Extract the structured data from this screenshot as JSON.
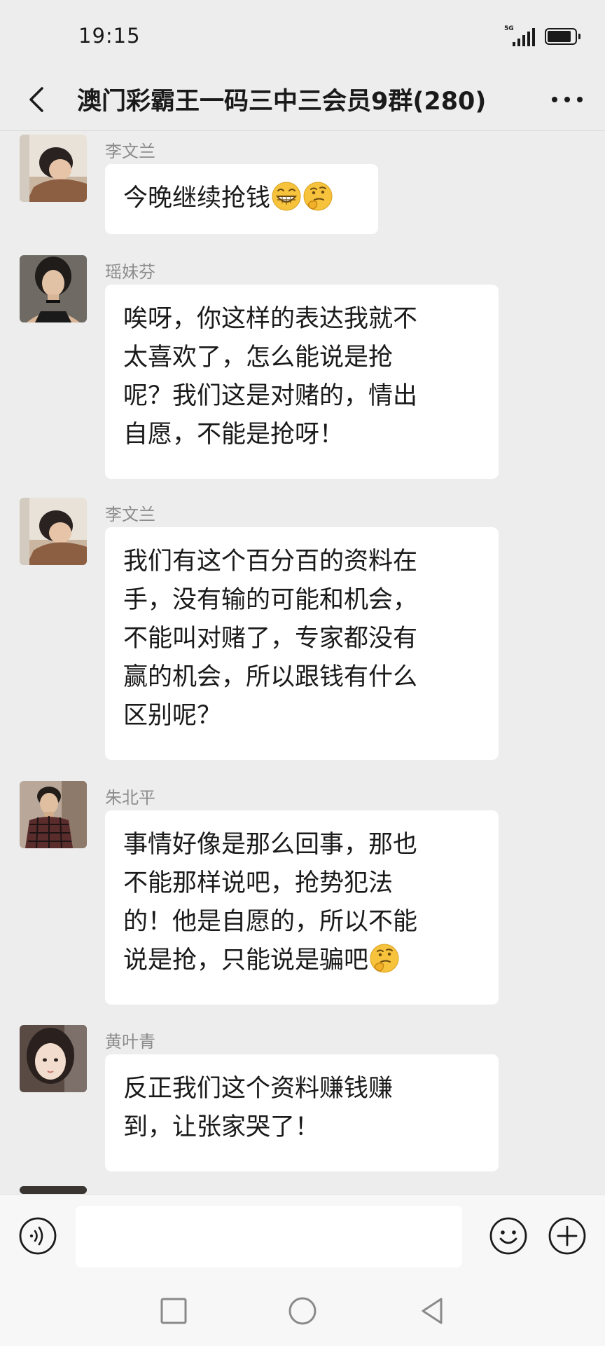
{
  "status_bar": {
    "time": "19:15",
    "network": "5G",
    "battery_level": 0.9
  },
  "header": {
    "back_icon": "chevron-left-icon",
    "title": "澳门彩霸王一码三中三会员9群(280)",
    "more_icon": "ellipsis-icon"
  },
  "messages": [
    {
      "sender": "李文兰",
      "avatar": "woman-lying-photo",
      "lines": [
        "今晚继续抢钱"
      ],
      "emojis": [
        "grinning-face",
        "thinking-face"
      ]
    },
    {
      "sender": "瑶妹芬",
      "avatar": "woman-choker-photo",
      "lines": [
        "唉呀，你这样的表达我就不",
        "太喜欢了，怎么能说是抢",
        "呢？我们这是对赌的，情出",
        "自愿，不能是抢呀！"
      ],
      "emojis": []
    },
    {
      "sender": "李文兰",
      "avatar": "woman-lying-photo",
      "lines": [
        "我们有这个百分百的资料在",
        "手，没有输的可能和机会，",
        "不能叫对赌了，专家都没有",
        "赢的机会，所以跟钱有什么",
        "区别呢？"
      ],
      "emojis": []
    },
    {
      "sender": "朱北平",
      "avatar": "man-plaid-shirt-photo",
      "lines": [
        "事情好像是那么回事，那也",
        "不能那样说吧，抢势犯法",
        "的！他是自愿的，所以不能",
        "说是抢，只能说是骗吧"
      ],
      "emojis": [
        "thinking-face"
      ]
    },
    {
      "sender": "黄叶青",
      "avatar": "girl-selfie-photo",
      "lines": [
        "反正我们这个资料赚钱赚",
        "到，让张家哭了！"
      ],
      "emojis": []
    }
  ],
  "input_bar": {
    "voice_icon": "voice-icon",
    "placeholder": "",
    "emoji_icon": "smiley-icon",
    "plus_icon": "plus-icon"
  },
  "nav_bar": {
    "recent_icon": "square-icon",
    "home_icon": "circle-icon",
    "back_icon": "triangle-back-icon"
  },
  "colors": {
    "background": "#ededed",
    "bubble": "#ffffff",
    "text": "#1a1a1a",
    "sender_name": "#8c8c8c",
    "emoji_yellow": "#f7c23c"
  }
}
